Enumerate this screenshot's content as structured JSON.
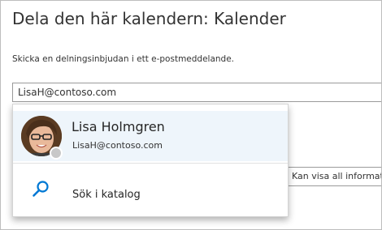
{
  "dialog": {
    "title": "Dela den här kalendern: Kalender",
    "instruction": "Skicka en delningsinbjudan i ett e-postmeddelande."
  },
  "recipient": {
    "value": "LisaH@contoso.com"
  },
  "permission": {
    "value": "Kan visa all information"
  },
  "suggestions": {
    "person": {
      "name": "Lisa Holmgren",
      "email": "LisaH@contoso.com",
      "presence": "offline"
    },
    "search_directory": {
      "label": "Sök i katalog",
      "icon": "search-icon"
    }
  },
  "colors": {
    "accent": "#0078d4",
    "highlight": "#eef5fb"
  }
}
